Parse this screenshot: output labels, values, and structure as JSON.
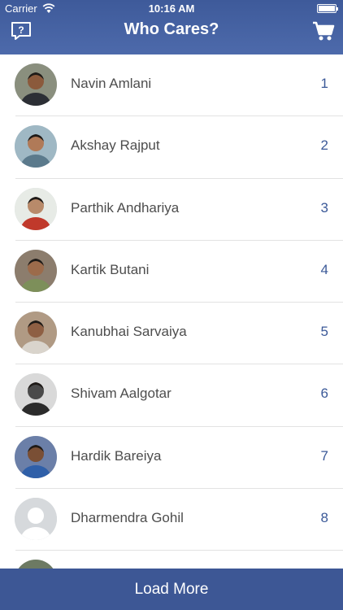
{
  "status_bar": {
    "carrier": "Carrier",
    "time": "10:16 AM"
  },
  "header": {
    "title": "Who Cares?",
    "left_icon": "help-chat-icon",
    "right_icon": "cart-icon"
  },
  "colors": {
    "header": "#4d6aab",
    "accent": "#3b5998",
    "load_more": "#3d5795"
  },
  "people": [
    {
      "name": "Navin Amlani",
      "rank": "1",
      "bg": "#8a8f7e",
      "skin": "#8b5a3c",
      "shirt": "#2c2f35"
    },
    {
      "name": "Akshay Rajput",
      "rank": "2",
      "bg": "#9fb8c4",
      "skin": "#b07a58",
      "shirt": "#5b7a8c"
    },
    {
      "name": "Parthik Andhariya",
      "rank": "3",
      "bg": "#e7ebe6",
      "skin": "#b88a6a",
      "shirt": "#c0392b"
    },
    {
      "name": "Kartik Butani",
      "rank": "4",
      "bg": "#8c7d6d",
      "skin": "#9c6b4b",
      "shirt": "#7d8f5a"
    },
    {
      "name": "Kanubhai Sarvaiya",
      "rank": "5",
      "bg": "#b09a84",
      "skin": "#8e5f43",
      "shirt": "#d9d4cc"
    },
    {
      "name": "Shivam Aalgotar",
      "rank": "6",
      "bg": "#d9d9d9",
      "skin": "#4a4a4a",
      "shirt": "#2b2b2b"
    },
    {
      "name": "Hardik Bareiya",
      "rank": "7",
      "bg": "#6b7fa8",
      "skin": "#7a4f35",
      "shirt": "#2f5fa8"
    },
    {
      "name": "Dharmendra Gohil",
      "rank": "8",
      "bg": "#d6d9dc",
      "skin": "#ffffff",
      "shirt": "#ffffff",
      "placeholder": true
    },
    {
      "name": "",
      "rank": "",
      "bg": "#6d7a63",
      "skin": "#7e5a40",
      "shirt": "#3a3a3a"
    }
  ],
  "footer": {
    "load_more_label": "Load More"
  }
}
